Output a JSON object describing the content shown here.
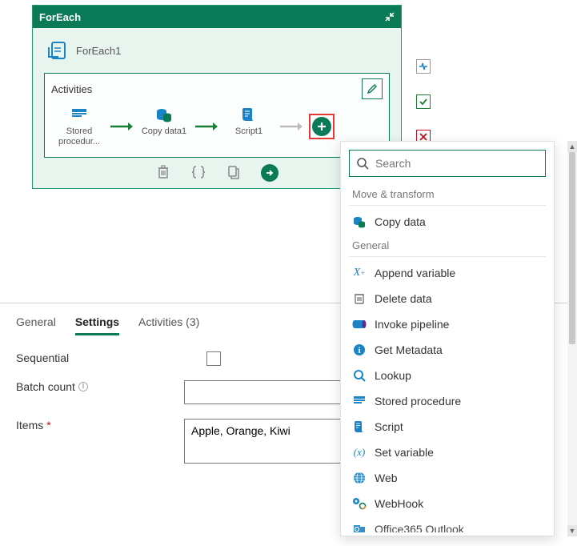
{
  "card": {
    "title": "ForEach",
    "foreach_label": "ForEach1",
    "activities_title": "Activities",
    "nodes": [
      {
        "label": "Stored procedur..."
      },
      {
        "label": "Copy data1"
      },
      {
        "label": "Script1"
      }
    ]
  },
  "tabs": {
    "general": "General",
    "settings": "Settings",
    "activities": "Activities (3)"
  },
  "form": {
    "sequential_label": "Sequential",
    "batch_count_label": "Batch count",
    "items_label": "Items",
    "items_value": "Apple, Orange, Kiwi"
  },
  "dropdown": {
    "search_placeholder": "Search",
    "sections": {
      "move_transform": "Move & transform",
      "general": "General"
    },
    "items": {
      "copy_data": "Copy data",
      "append_variable": "Append variable",
      "delete_data": "Delete data",
      "invoke_pipeline": "Invoke pipeline",
      "get_metadata": "Get Metadata",
      "lookup": "Lookup",
      "stored_procedure": "Stored procedure",
      "script": "Script",
      "set_variable": "Set variable",
      "web": "Web",
      "webhook": "WebHook",
      "office365_outlook": "Office365 Outlook"
    }
  }
}
